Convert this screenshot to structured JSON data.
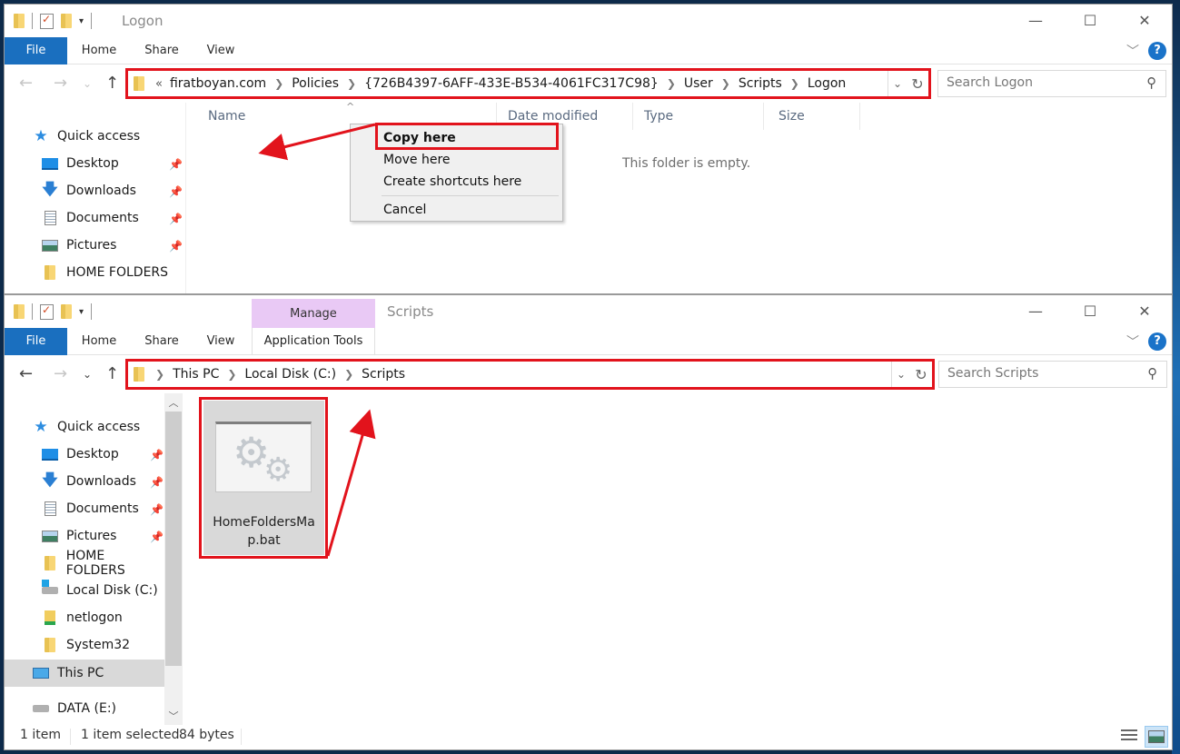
{
  "top_window": {
    "title": "Logon",
    "ribbon_tabs": [
      "File",
      "Home",
      "Share",
      "View"
    ],
    "address": {
      "overflow": "«",
      "crumbs": [
        "firatboyan.com",
        "Policies",
        "{726B4397-6AFF-433E-B534-4061FC317C98}",
        "User",
        "Scripts",
        "Logon"
      ]
    },
    "search_placeholder": "Search Logon",
    "nav": [
      {
        "label": "Quick access",
        "icon": "star-icon"
      },
      {
        "label": "Desktop",
        "icon": "desktop-icon",
        "pinned": true
      },
      {
        "label": "Downloads",
        "icon": "downloads-icon",
        "pinned": true
      },
      {
        "label": "Documents",
        "icon": "documents-icon",
        "pinned": true
      },
      {
        "label": "Pictures",
        "icon": "pictures-icon",
        "pinned": true
      },
      {
        "label": "HOME FOLDERS",
        "icon": "folder-icon"
      }
    ],
    "columns": [
      "Name",
      "Date modified",
      "Type",
      "Size"
    ],
    "empty_message": "This folder is empty.",
    "context_menu": {
      "items": [
        "Copy here",
        "Move here",
        "Create shortcuts here"
      ],
      "cancel": "Cancel",
      "default_item": "Copy here"
    }
  },
  "bottom_window": {
    "title": "Scripts",
    "contextual_group": "Manage",
    "contextual_tab": "Application Tools",
    "ribbon_tabs": [
      "File",
      "Home",
      "Share",
      "View"
    ],
    "address": {
      "crumbs": [
        "This PC",
        "Local Disk (C:)",
        "Scripts"
      ]
    },
    "search_placeholder": "Search Scripts",
    "nav": [
      {
        "label": "Quick access",
        "icon": "star-icon"
      },
      {
        "label": "Desktop",
        "icon": "desktop-icon",
        "pinned": true
      },
      {
        "label": "Downloads",
        "icon": "downloads-icon",
        "pinned": true
      },
      {
        "label": "Documents",
        "icon": "documents-icon",
        "pinned": true
      },
      {
        "label": "Pictures",
        "icon": "pictures-icon",
        "pinned": true
      },
      {
        "label": "HOME FOLDERS",
        "icon": "folder-icon"
      },
      {
        "label": "Local Disk (C:)",
        "icon": "drive-icon"
      },
      {
        "label": "netlogon",
        "icon": "shared-folder-icon"
      },
      {
        "label": "System32",
        "icon": "folder-icon"
      },
      {
        "label": "This PC",
        "icon": "computer-icon",
        "selected": true
      },
      {
        "label": "DATA (E:)",
        "icon": "drive-icon"
      }
    ],
    "file": {
      "name_line1": "HomeFoldersMa",
      "name_line2": "p.bat",
      "selected": true
    },
    "status": {
      "count": "1 item",
      "selection": "1 item selected",
      "size": "84 bytes"
    }
  },
  "icons": {
    "chevron": "›",
    "back": "←",
    "forward": "→",
    "up": "↑",
    "recent": "⌄",
    "refresh": "↻",
    "search": "⚲",
    "minimize": "—",
    "maximize": "☐",
    "close": "✕",
    "pin": "📌"
  },
  "colors": {
    "file_tab": "#1a6fbf",
    "highlight": "#e2131c",
    "manage_tab": "#e9c9f5",
    "selection": "#d9d9d9"
  }
}
